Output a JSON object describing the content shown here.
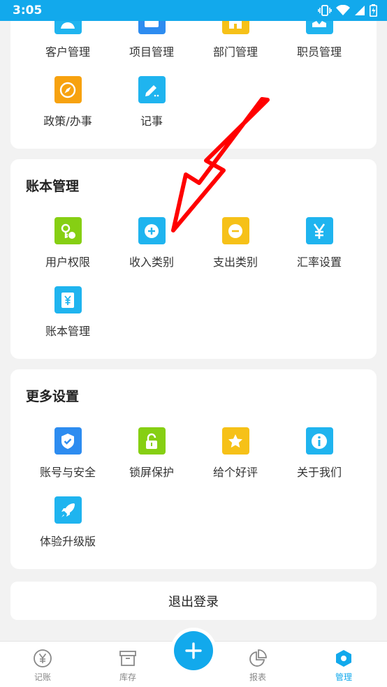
{
  "status": {
    "time": "3:05"
  },
  "sections": {
    "basic": {
      "items": [
        {
          "label": "客户管理"
        },
        {
          "label": "项目管理"
        },
        {
          "label": "部门管理"
        },
        {
          "label": "职员管理"
        },
        {
          "label": "政策/办事"
        },
        {
          "label": "记事"
        }
      ]
    },
    "ledger": {
      "title": "账本管理",
      "items": [
        {
          "label": "用户权限"
        },
        {
          "label": "收入类别"
        },
        {
          "label": "支出类别"
        },
        {
          "label": "汇率设置"
        },
        {
          "label": "账本管理"
        }
      ]
    },
    "more": {
      "title": "更多设置",
      "items": [
        {
          "label": "账号与安全"
        },
        {
          "label": "锁屏保护"
        },
        {
          "label": "给个好评"
        },
        {
          "label": "关于我们"
        },
        {
          "label": "体验升级版"
        }
      ]
    }
  },
  "logout_label": "退出登录",
  "bottom_nav": [
    {
      "label": "记账"
    },
    {
      "label": "库存"
    },
    {
      "label": "报表"
    },
    {
      "label": "管理"
    }
  ],
  "colors": {
    "accent": "#12a9ec",
    "annotation": "#ff0000",
    "icon_blue": "#1fb4ef",
    "icon_dark_blue": "#2d8cf0",
    "icon_green": "#86cf13",
    "icon_yellow": "#f6c118",
    "icon_orange": "#f7a20f"
  }
}
